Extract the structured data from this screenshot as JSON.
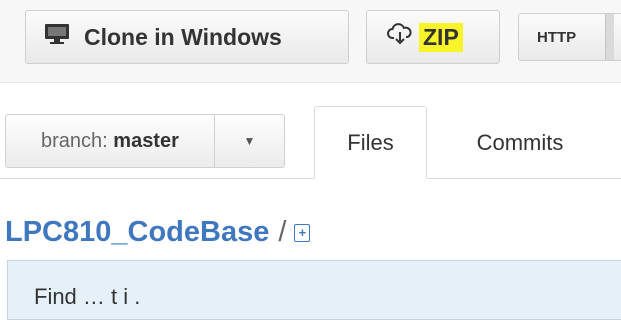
{
  "toolbar": {
    "clone_label": "Clone in Windows",
    "zip_label": "ZIP",
    "http_label": "HTTP",
    "zip_highlight_color": "#f7f52a"
  },
  "branch": {
    "prefix": "branch:",
    "name": "master"
  },
  "tabs": [
    {
      "label": "Files",
      "active": true
    },
    {
      "label": "Commits",
      "active": false
    }
  ],
  "repo": {
    "name": "LPC810_CodeBase",
    "separator": "/",
    "add_icon": "plus-box-icon"
  },
  "finder": {
    "text": "Find … t i ."
  },
  "colors": {
    "link": "#4078c0",
    "finder_bg": "#e5f0f8"
  }
}
